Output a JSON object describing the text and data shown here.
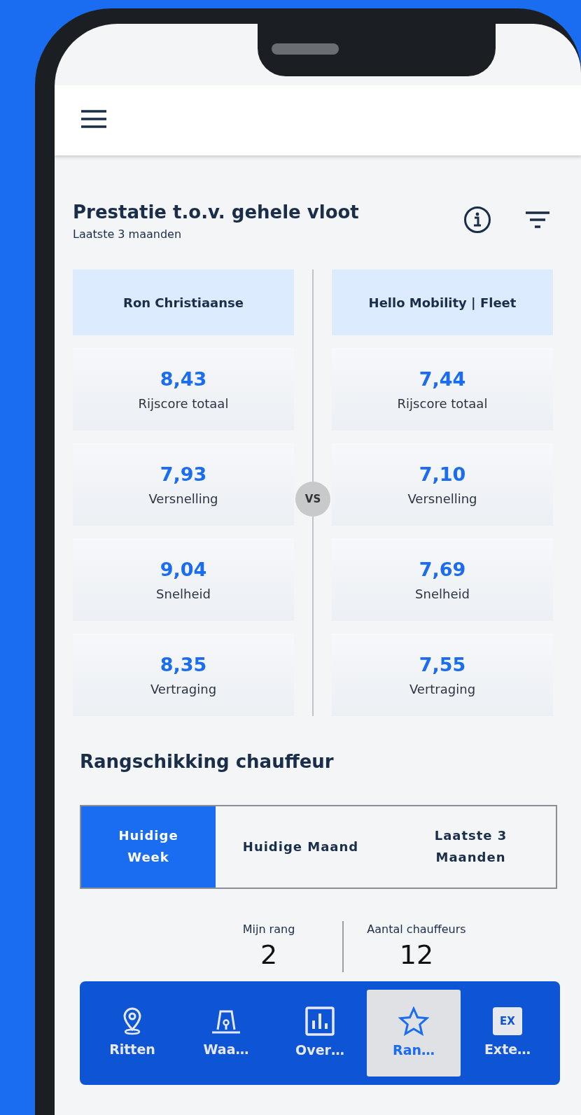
{
  "performance": {
    "title": "Prestatie t.o.v. gehele vloot",
    "subtitle": "Laatste 3 maanden",
    "vs": "VS",
    "columns": [
      {
        "name": "Ron Christiaanse",
        "metrics": [
          {
            "value": "8,43",
            "label": "Rijscore totaal"
          },
          {
            "value": "7,93",
            "label": "Versnelling"
          },
          {
            "value": "9,04",
            "label": "Snelheid"
          },
          {
            "value": "8,35",
            "label": "Vertraging"
          }
        ]
      },
      {
        "name": "Hello Mobility | Fleet",
        "metrics": [
          {
            "value": "7,44",
            "label": "Rijscore totaal"
          },
          {
            "value": "7,10",
            "label": "Versnelling"
          },
          {
            "value": "7,69",
            "label": "Snelheid"
          },
          {
            "value": "7,55",
            "label": "Vertraging"
          }
        ]
      }
    ]
  },
  "ranking": {
    "title": "Rangschikking chauffeur",
    "periods": [
      {
        "label": "Huidige Week",
        "selected": true
      },
      {
        "label": "Huidige Maand",
        "selected": false
      },
      {
        "label": "Laatste 3 Maanden",
        "selected": false
      }
    ],
    "stats": [
      {
        "label": "Mijn rang",
        "value": "2"
      },
      {
        "label": "Aantal chauffeurs",
        "value": "12"
      }
    ]
  },
  "bottom_nav": [
    {
      "kind": "pin",
      "label": "Ritten",
      "selected": false
    },
    {
      "kind": "beacon",
      "label": "Waa…",
      "selected": false
    },
    {
      "kind": "chart",
      "label": "Over…",
      "selected": false
    },
    {
      "kind": "star",
      "label": "Ran…",
      "selected": true
    },
    {
      "kind": "ex",
      "label": "Exte…",
      "selected": false,
      "badge": "EX"
    }
  ]
}
